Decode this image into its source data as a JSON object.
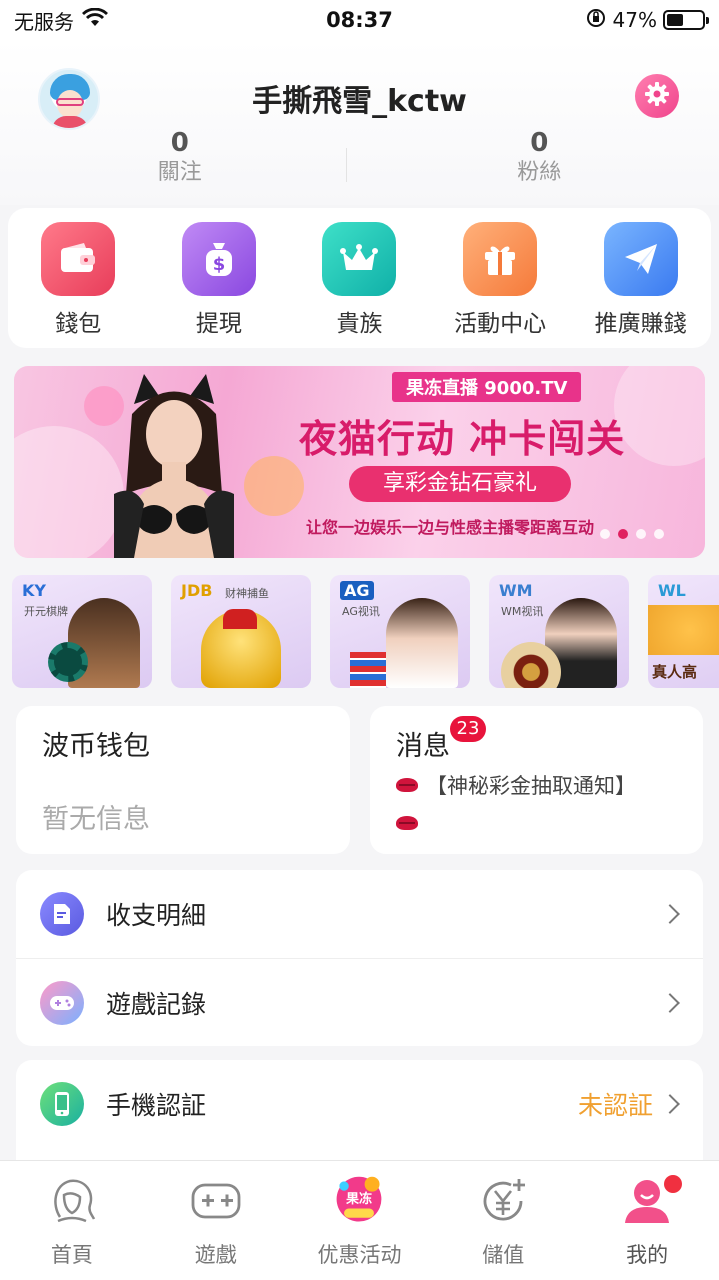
{
  "status_bar": {
    "carrier": "无服务",
    "time": "08:37",
    "battery_percent": "47%",
    "battery_level": 0.47,
    "icons": [
      "wifi-icon",
      "rotation-lock-icon",
      "battery-icon"
    ]
  },
  "profile": {
    "username": "手撕飛雪_kctw",
    "following_count": "0",
    "following_label": "關注",
    "fans_count": "0",
    "fans_label": "粉絲"
  },
  "quick_menu": [
    {
      "label": "錢包",
      "icon": "wallet-icon",
      "color": "#f0506a"
    },
    {
      "label": "提現",
      "icon": "money-bag-icon",
      "color": "#a05ee8"
    },
    {
      "label": "貴族",
      "icon": "crown-icon",
      "color": "#22c7b8"
    },
    {
      "label": "活動中心",
      "icon": "gift-icon",
      "color": "#ff8a4a"
    },
    {
      "label": "推廣賺錢",
      "icon": "paper-plane-icon",
      "color": "#4a8ff0"
    }
  ],
  "banner": {
    "tag": "果冻直播 9000.TV",
    "title": "夜猫行动 冲卡闯关",
    "subtitle": "享彩金钻石豪礼",
    "description": "让您一边娱乐一边与性感主播零距离互动"
  },
  "game_strip": [
    {
      "logo": "KY",
      "sublabel": "开元棋牌",
      "logo_color": "#2a6fd6"
    },
    {
      "logo": "JDB",
      "sublabel": "财神捕鱼",
      "logo_color": "#e0a000"
    },
    {
      "logo": "AG",
      "sublabel": "AG视讯",
      "logo_color": "#1a5fc0"
    },
    {
      "logo": "WM",
      "sublabel": "WM视讯",
      "logo_color": "#3a7fd0"
    },
    {
      "logo": "WL",
      "sublabel": "真人高",
      "logo_color": "#2a9ad6"
    }
  ],
  "wallet_card": {
    "title": "波币钱包",
    "empty_text": "暂无信息"
  },
  "message_card": {
    "title": "消息",
    "badge": "23",
    "lines": [
      "【神秘彩金抽取通知】",
      ""
    ]
  },
  "list_group_1": [
    {
      "label": "收支明細",
      "icon": "document-edit-icon"
    },
    {
      "label": "遊戲記錄",
      "icon": "gamepad-icon"
    }
  ],
  "list_group_2": [
    {
      "label": "手機認証",
      "icon": "phone-icon",
      "status": "未認証"
    }
  ],
  "tab_bar": [
    {
      "label": "首頁",
      "icon": "home-face-icon"
    },
    {
      "label": "遊戲",
      "icon": "gamepad-outline-icon"
    },
    {
      "label": "优惠活动",
      "icon": "promo-badge-icon"
    },
    {
      "label": "儲值",
      "icon": "yen-plus-icon"
    },
    {
      "label": "我的",
      "icon": "user-icon"
    }
  ]
}
